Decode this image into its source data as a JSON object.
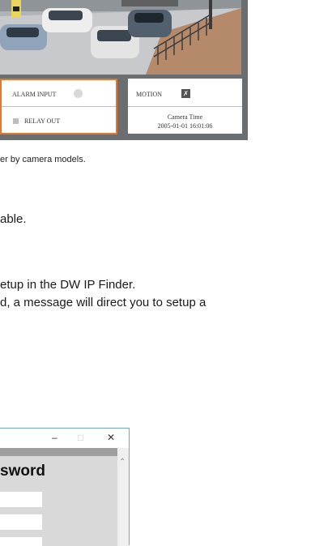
{
  "camera_panel": {
    "alarm_input_label": "ALARM INPUT",
    "relay_out_label": "RELAY OUT",
    "motion_label": "MOTION",
    "camera_time_label": "Camera Time",
    "camera_time_value": "2005-01-01 16:01:06",
    "highlight_color": "#e9772a"
  },
  "document": {
    "caption": "er by camera models.",
    "lines": [
      "able.",
      "etup in the DW IP Finder.",
      "d, a message will direct you to setup a"
    ]
  },
  "dialog": {
    "heading": "sword",
    "minimize_icon": "minimize-icon",
    "maximize_icon": "maximize-icon",
    "close_icon": "close-icon",
    "scroll_up_icon": "chevron-up-icon",
    "frame_color": "#6ea6d6"
  }
}
